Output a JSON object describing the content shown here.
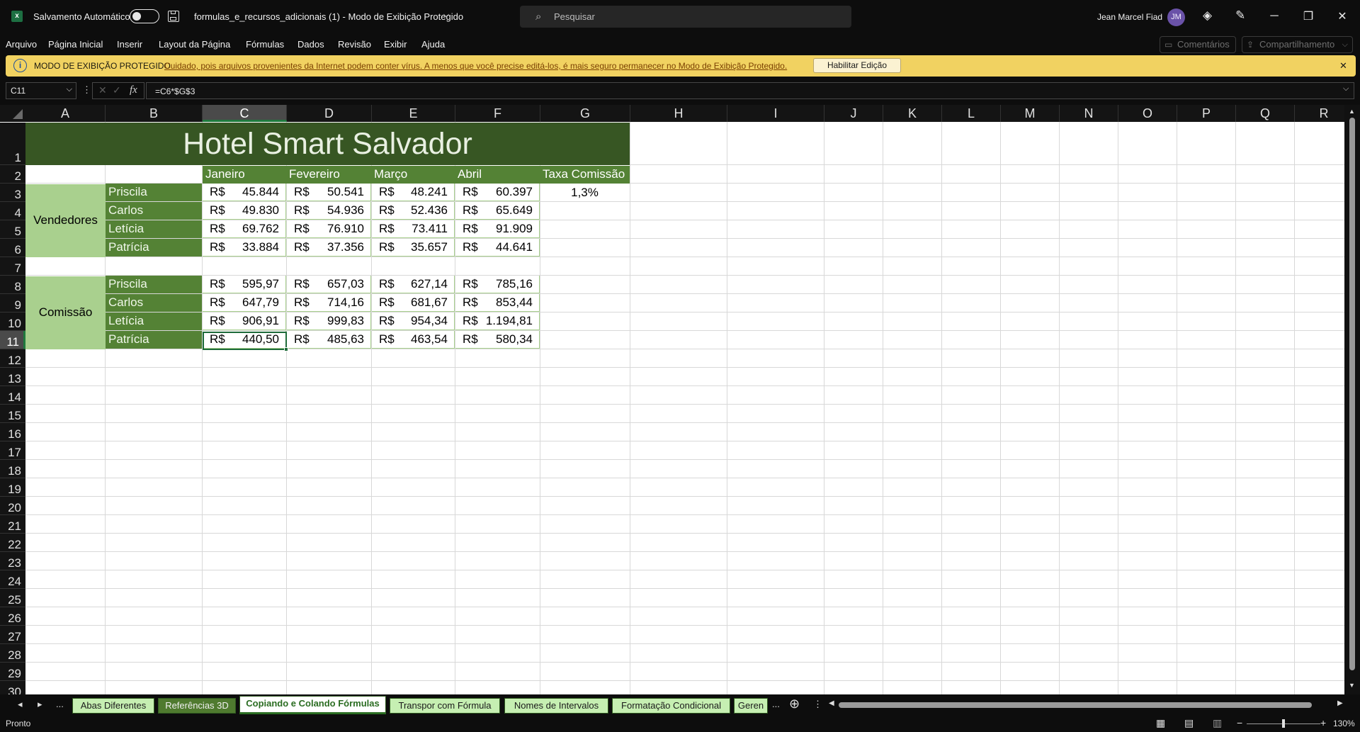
{
  "titlebar": {
    "autosave_label": "Salvamento Automático",
    "doc_title": "formulas_e_recursos_adicionais (1)  -  Modo de Exibição Protegido",
    "search_placeholder": "Pesquisar",
    "user_name": "Jean Marcel Fiad",
    "user_initials": "JM",
    "minimize": "─",
    "restore": "❐",
    "close": "✕"
  },
  "menu": {
    "items": [
      "Arquivo",
      "Página Inicial",
      "Inserir",
      "Layout da Página",
      "Fórmulas",
      "Dados",
      "Revisão",
      "Exibir",
      "Ajuda"
    ],
    "comments": "Comentários",
    "share": "Compartilhamento"
  },
  "banner": {
    "title": "MODO DE EXIBIÇÃO PROTEGIDO",
    "message": "Cuidado, pois arquivos provenientes da Internet podem conter vírus. A menos que você precise editá-los, é mais seguro permanecer no Modo de  Exibição Protegido.",
    "button": "Habilitar Edição",
    "close": "✕"
  },
  "formula_bar": {
    "name_box": "C11",
    "fx": "fx",
    "formula": "=C6*$G$3"
  },
  "columns": [
    "A",
    "B",
    "C",
    "D",
    "E",
    "F",
    "G",
    "H",
    "I",
    "J",
    "K",
    "L",
    "M",
    "N",
    "O",
    "P",
    "Q",
    "R"
  ],
  "rows": [
    "1",
    "2",
    "3",
    "4",
    "5",
    "6",
    "7",
    "8",
    "9",
    "10",
    "11",
    "12",
    "13",
    "14",
    "15",
    "16",
    "17",
    "18",
    "19",
    "20",
    "21",
    "22",
    "23",
    "24",
    "25",
    "26",
    "27",
    "28",
    "29",
    "30"
  ],
  "sheet": {
    "title": "Hotel Smart Salvador",
    "months": [
      "Janeiro",
      "Fevereiro",
      "Março",
      "Abril"
    ],
    "rate_header": "Taxa Comissão",
    "rate_value": "1,3%",
    "currency": "R$",
    "group_sales": "Vendedores",
    "group_commission": "Comissão",
    "names": [
      "Priscila",
      "Carlos",
      "Letícia",
      "Patrícia"
    ],
    "sales": [
      [
        "45.844",
        "50.541",
        "48.241",
        "60.397"
      ],
      [
        "49.830",
        "54.936",
        "52.436",
        "65.649"
      ],
      [
        "69.762",
        "76.910",
        "73.411",
        "91.909"
      ],
      [
        "33.884",
        "37.356",
        "35.657",
        "44.641"
      ]
    ],
    "commissions": [
      [
        "595,97",
        "657,03",
        "627,14",
        "785,16"
      ],
      [
        "647,79",
        "714,16",
        "681,67",
        "853,44"
      ],
      [
        "906,91",
        "999,83",
        "954,34",
        "1.194,81"
      ],
      [
        "440,50",
        "485,63",
        "463,54",
        "580,34"
      ]
    ]
  },
  "tabs": [
    "Abas Diferentes",
    "Referências 3D",
    "Copiando e Colando Fórmulas",
    "Transpor com Fórmula",
    "Nomes de Intervalos",
    "Formatação Condicional",
    "Geren"
  ],
  "tab_nav": {
    "prev": "◂",
    "next": "▸",
    "more": "...",
    "add": "⊕"
  },
  "status": {
    "ready": "Pronto",
    "zoom": "130%"
  },
  "colors": {
    "dark_green": "#375623",
    "mid_green": "#548235",
    "light_green": "#a9d08e",
    "banner": "#f1d261"
  }
}
